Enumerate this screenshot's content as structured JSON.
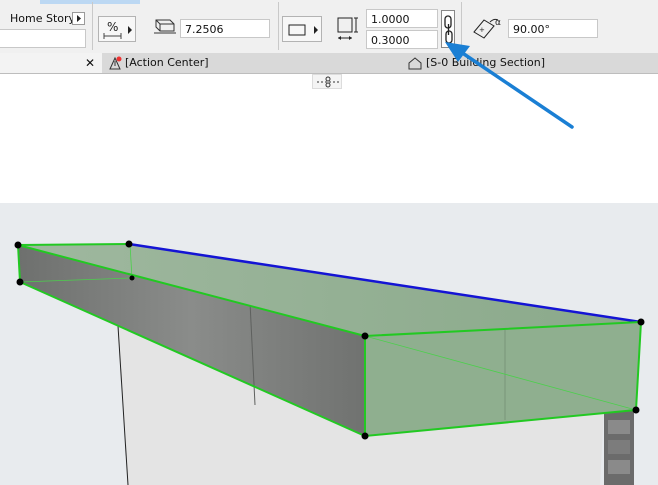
{
  "toolbar": {
    "story_label": "Home Story",
    "thickness_value": "7.2506",
    "height_value": "1.0000",
    "width_value": "0.3000",
    "angle_value": "90.00°"
  },
  "tabs": [
    {
      "label": "[Action Center]"
    },
    {
      "label": "[S-0  Building Section]"
    }
  ],
  "close_glyph": "✕",
  "colors": {
    "annotation_arrow": "#1a7fd4",
    "outline_green": "#22c922",
    "outline_blue": "#1414d4",
    "slab_face": "#8fb08f"
  },
  "icons": [
    "arrow-right-icon",
    "percent-icon",
    "layers-icon",
    "rectangle-icon",
    "dimension-icon",
    "link-chain-icon",
    "angle-icon",
    "building-icon",
    "scissors-icon",
    "alert-icon"
  ]
}
